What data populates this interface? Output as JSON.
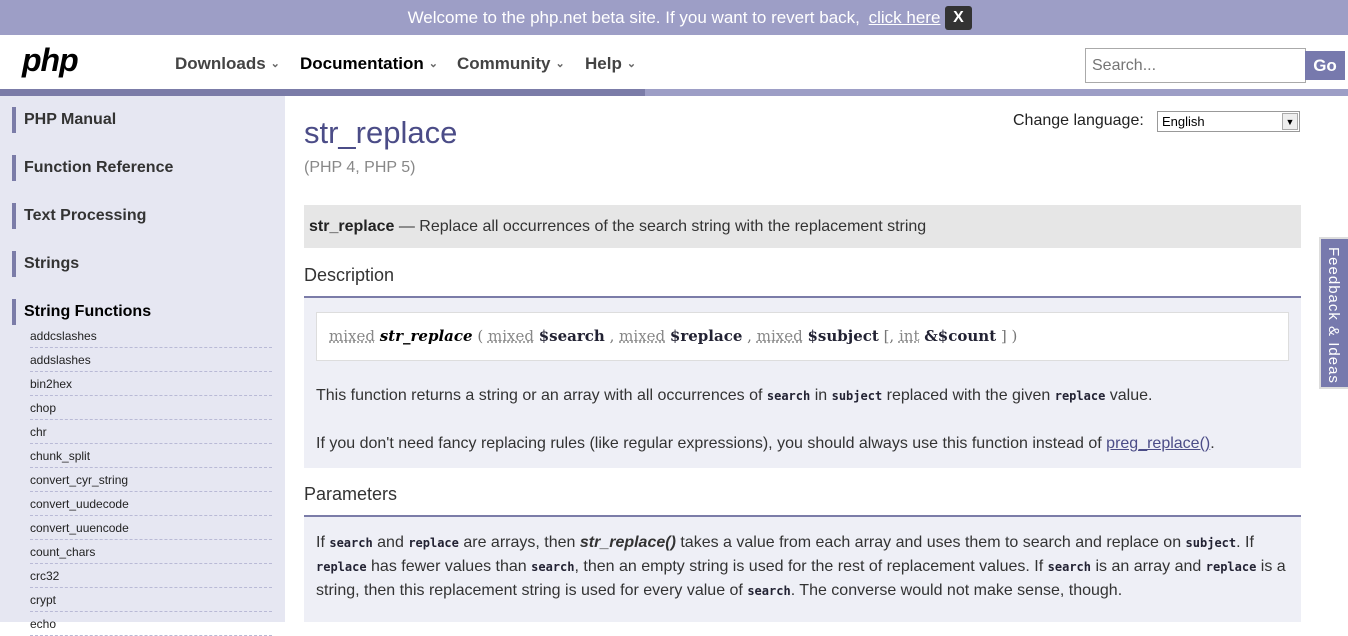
{
  "banner": {
    "message": "Welcome to the php.net beta site. If you want to revert back,",
    "link": "click here",
    "close": "X"
  },
  "header": {
    "logo": "php",
    "nav": [
      {
        "label": "Downloads"
      },
      {
        "label": "Documentation"
      },
      {
        "label": "Community"
      },
      {
        "label": "Help"
      }
    ],
    "search_placeholder": "Search...",
    "go": "Go"
  },
  "sidebar": {
    "breadcrumbs": [
      "PHP Manual",
      "Function Reference",
      "Text Processing",
      "Strings",
      "String Functions"
    ],
    "functions": [
      "addcslashes",
      "addslashes",
      "bin2hex",
      "chop",
      "chr",
      "chunk_split",
      "convert_cyr_string",
      "convert_uudecode",
      "convert_uuencode",
      "count_chars",
      "crc32",
      "crypt",
      "echo"
    ]
  },
  "main": {
    "title": "str_replace",
    "versions": "(PHP 4, PHP 5)",
    "language_label": "Change language:",
    "language_value": "English",
    "refpurpose_name": "str_replace",
    "refpurpose_text": "— Replace all occurrences of the search string with the replacement string",
    "description_heading": "Description",
    "synopsis": {
      "ret_type": "mixed",
      "name": "str_replace",
      "open": "(",
      "t1": "mixed",
      "v1": "$search",
      "comma1": ",",
      "t2": "mixed",
      "v2": "$replace",
      "comma2": ",",
      "t3": "mixed",
      "v3": "$subject",
      "opt_open": "[,",
      "t4": "int",
      "v4": "&$count",
      "opt_close": "]",
      "close": ")"
    },
    "desc_p1": {
      "a": "This function returns a string or an array with all occurrences of",
      "c1": "search",
      "b": "in",
      "c2": "subject",
      "d": "replaced with the given",
      "c3": "replace",
      "e": "value."
    },
    "desc_p2": {
      "a": "If you don't need fancy replacing rules (like regular expressions), you should always use this function instead of",
      "link": "preg_replace()",
      "b": "."
    },
    "parameters_heading": "Parameters",
    "param_p": {
      "l1_a": "If",
      "l1_c1": "search",
      "l1_b": "and",
      "l1_c2": "replace",
      "l1_c": "are arrays, then",
      "l1_fn": "str_replace()",
      "l1_d": "takes a value from each array and uses them to search and replace on",
      "l1_c3": "subject",
      "l1_e": ". If",
      "l2_c1": "replace",
      "l2_a": "has fewer values than",
      "l2_c2": "search",
      "l2_b": ", then an empty string is used for the rest of replacement values. If",
      "l2_c3": "search",
      "l2_c": "is an array and",
      "l2_c4": "replace",
      "l3_a": "is a string, then this replacement string is used for every value of",
      "l3_c1": "search",
      "l3_b": ". The converse would not make sense, though."
    }
  },
  "feedback": "Feedback & Ideas",
  "colors": {
    "brand": "#7779ad",
    "banner": "#9d9ec6",
    "title": "#4b4c87",
    "sidebar": "#e6e7f2"
  }
}
